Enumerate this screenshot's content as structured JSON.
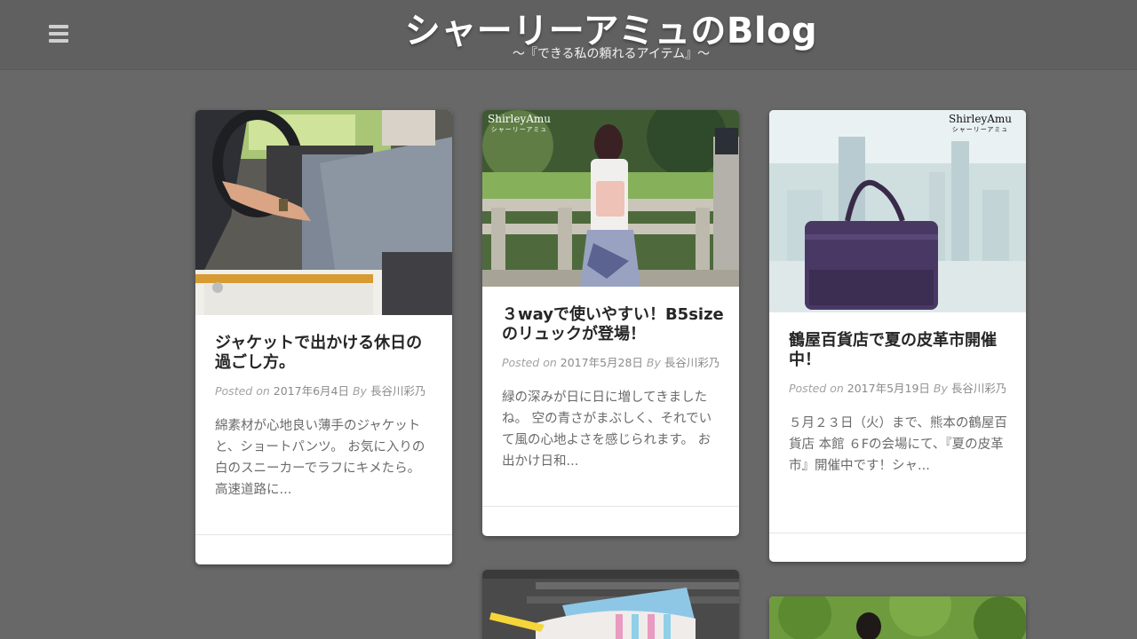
{
  "header": {
    "site_title": "シャーリーアミュのBlog",
    "tagline": "～『できる私の頼れるアイテム』～",
    "menu_icon": "hamburger-menu-icon"
  },
  "posts": [
    {
      "title": "ジャケットで出かける休日の過ごし方。",
      "posted_on": "Posted on",
      "date": "2017年6月4日",
      "by": "By",
      "author": "長谷川彩乃",
      "excerpt": "綿素材が心地良い薄手のジャケットと、ショートパンツ。 お気に入りの白のスニーカーでラフにキメたら。 高速道路に..."
    },
    {
      "title": "３wayで使いやすい！B5sizeのリュックが登場！",
      "posted_on": "Posted on",
      "date": "2017年5月28日",
      "by": "By",
      "author": "長谷川彩乃",
      "excerpt": "緑の深みが日に日に増してきましたね。 空の青さがまぶしく、それでいて風の心地よさを感じられます。 お出かけ日和...",
      "watermark": "ShirleyAmu",
      "watermark_sub": "シャーリーアミュ"
    },
    {
      "title": "鶴屋百貨店で夏の皮革市開催中！",
      "posted_on": "Posted on",
      "date": "2017年5月19日",
      "by": "By",
      "author": "長谷川彩乃",
      "excerpt": "５月２３日（火）まで、熊本の鶴屋百貨店 本館 ６Fの会場にて、『夏の皮革市』開催中です！シャ...",
      "watermark": "ShirleyAmu",
      "watermark_sub": "シャーリーアミュ"
    }
  ],
  "colors": {
    "background": "#686868",
    "header": "#606060",
    "card": "#ffffff",
    "title_text": "#262626",
    "meta_text": "#8a8a8a"
  }
}
